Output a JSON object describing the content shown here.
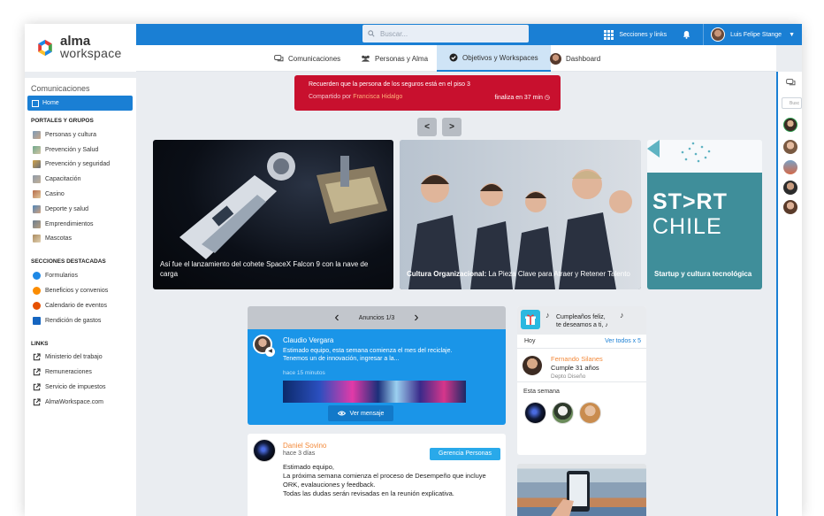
{
  "brand": {
    "line1": "alma",
    "line2": "workspace",
    "colors": [
      "#e53935",
      "#43a047",
      "#1e88e5",
      "#fbc02d"
    ]
  },
  "topbar": {
    "search_placeholder": "Buscar...",
    "sections_label": "Secciones y links",
    "user_name": "Luis Felipe Stange",
    "accent": "#1a7fd4"
  },
  "tabs": [
    {
      "label": "Comunicaciones",
      "icon": "chat-icon"
    },
    {
      "label": "Personas y Alma",
      "icon": "people-icon"
    },
    {
      "label": "Objetivos y Workspaces",
      "icon": "check-circle-icon",
      "active": true
    },
    {
      "label": "Dashboard",
      "icon": "avatar-icon"
    }
  ],
  "sidebar": {
    "title": "Comunicaciones",
    "home_label": "Home",
    "groups": [
      {
        "title": "PORTALES Y GRUPOS",
        "items": [
          {
            "label": "Personas y cultura",
            "icon": "thumb-icon"
          },
          {
            "label": "Prevención y Salud",
            "icon": "thumb-icon"
          },
          {
            "label": "Prevención y seguridad",
            "icon": "thumb-icon"
          },
          {
            "label": "Capacitación",
            "icon": "thumb-icon"
          },
          {
            "label": "Casino",
            "icon": "thumb-icon"
          },
          {
            "label": "Deporte y salud",
            "icon": "thumb-icon"
          },
          {
            "label": "Emprendimientos",
            "icon": "thumb-icon"
          },
          {
            "label": "Mascotas",
            "icon": "thumb-icon"
          }
        ]
      },
      {
        "title": "SECCIONES DESTACADAS",
        "items": [
          {
            "label": "Formularios",
            "icon": "form-icon",
            "color": "#1e88e5"
          },
          {
            "label": "Beneficios y convenios",
            "icon": "gift-icon",
            "color": "#fb8c00"
          },
          {
            "label": "Calendario de eventos",
            "icon": "calendar-icon",
            "color": "#e65100"
          },
          {
            "label": "Rendición de gastos",
            "icon": "receipt-icon",
            "color": "#1565c0"
          }
        ]
      },
      {
        "title": "LINKS",
        "items": [
          {
            "label": "Ministerio del trabajo",
            "icon": "external-link-icon"
          },
          {
            "label": "Remuneraciones",
            "icon": "external-link-icon"
          },
          {
            "label": "Servicio de impuestos",
            "icon": "external-link-icon"
          },
          {
            "label": "AlmaWorkspace.com",
            "icon": "external-link-icon"
          }
        ]
      }
    ]
  },
  "alert": {
    "message": "Recuerden que la persona de los seguros está en el piso 3",
    "shared_prefix": "Compartido por",
    "shared_by": "Francisca Hidalgo",
    "ends": "finaliza en 37 min",
    "color": "#c8102e"
  },
  "carousel": {
    "prev": "<",
    "next": ">",
    "cards": [
      {
        "caption_bold": "",
        "caption": "Así fue el lanzamiento del cohete SpaceX Falcon 9 con la nave de carga"
      },
      {
        "caption_bold": "Cultura Organizacional:",
        "caption": "La Pieza Clave para Atraer y Retener Talento"
      },
      {
        "caption_bold": "Startup y cultura tecnológica",
        "caption": "",
        "banner_line1": "ST>RT",
        "banner_line2": "CHILE"
      }
    ]
  },
  "announcements": {
    "header": "Anuncios 1/3",
    "featured": {
      "author": "Claudio Vergara",
      "text": "Estimado equipo, esta semana comienza el mes del reciclaje. Tenemos un de innovación, ingresar a la...",
      "time": "hace 15 minutos",
      "button": "Ver mensaje"
    }
  },
  "post": {
    "author": "Daniel Sovino",
    "time": "hace 3 días",
    "tag": "Gerencia Personas",
    "lines": [
      "Estimado equipo,",
      "La próxima semana comienza el proceso de Desempeño que incluye ORK, evalauciones y feedback.",
      "Todas las dudas serán revisadas en la reunión explicativa."
    ]
  },
  "birthdays": {
    "title_line1": "Cumpleaños feliz,",
    "title_line2": "te deseamos a ti, ♪",
    "note": "♪",
    "today_label": "Hoy",
    "see_all": "Ver todos x 5",
    "person": {
      "name": "Fernando Silanes",
      "detail": "Cumple 31 años",
      "dept": "Depto Diseño"
    },
    "week_label": "Esta semana"
  },
  "rail": {
    "search_placeholder": "Busc"
  }
}
